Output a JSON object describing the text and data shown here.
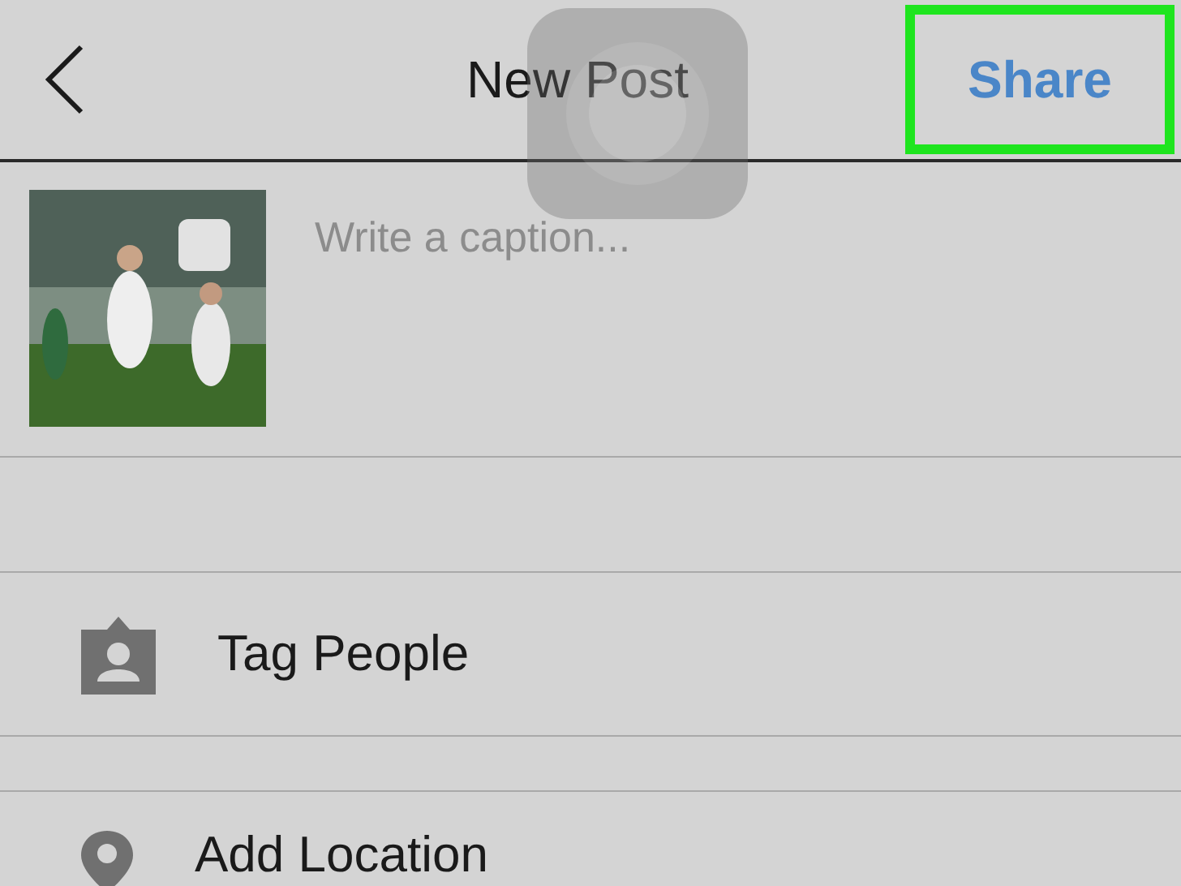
{
  "header": {
    "title": "New Post",
    "share_label": "Share",
    "share_highlighted": true
  },
  "post": {
    "caption": {
      "placeholder": "Write a caption..."
    }
  },
  "options": [
    {
      "kind": "tag",
      "label": "Tag People"
    },
    {
      "kind": "location",
      "label": "Add Location"
    }
  ]
}
